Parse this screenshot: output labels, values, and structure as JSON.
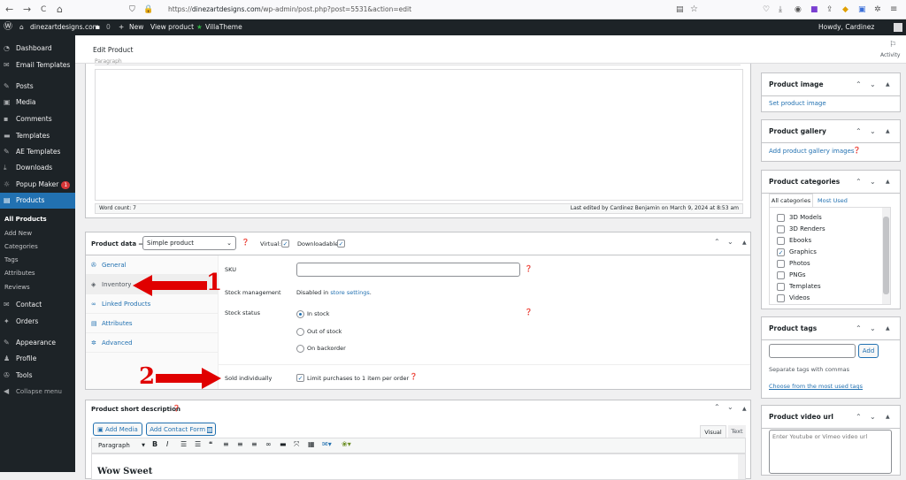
{
  "browser": {
    "url_prefix": "https://",
    "url_domain": "dinezartdesigns.com",
    "url_path": "/wp-admin/post.php?post=5531&action=edit",
    "back": "←",
    "forward": "→",
    "reload": "C",
    "home": "⌂"
  },
  "adminbar": {
    "site": "dinezartdesigns.com",
    "comments": "0",
    "new": "New",
    "view": "View product",
    "villa": "VillaTheme",
    "howdy": "Howdy, Cardinez Benjamin"
  },
  "menu": {
    "items": [
      "Dashboard",
      "Email Templates",
      "Posts",
      "Media",
      "Comments",
      "Templates",
      "AE Templates",
      "Downloads",
      "Popup Maker",
      "Products",
      "Contact",
      "Orders",
      "Appearance",
      "Profile",
      "Tools",
      "Collapse menu"
    ],
    "popup_badge": "1",
    "products_sub": [
      "All Products",
      "Add New",
      "Categories",
      "Tags",
      "Attributes",
      "Reviews"
    ]
  },
  "header": {
    "title": "Edit Product",
    "activity": "Activity"
  },
  "editor": {
    "toolbar_partial": "Paragraph",
    "word_count": "Word count: 7",
    "last_edited": "Last edited by Cardinez Benjamin on March 9, 2024 at 8:53 am"
  },
  "product_data": {
    "label": "Product data —",
    "type": "Simple product",
    "virtual": "Virtual:",
    "downloadable": "Downloadable:",
    "tabs": [
      "General",
      "Inventory",
      "Linked Products",
      "Attributes",
      "Advanced"
    ],
    "sku_label": "SKU",
    "stock_mgmt_label": "Stock management",
    "stock_mgmt_text": "Disabled in",
    "store_settings": "store settings",
    "stock_status_label": "Stock status",
    "stock_options": [
      "In stock",
      "Out of stock",
      "On backorder"
    ],
    "sold_ind_label": "Sold individually",
    "sold_ind_text": "Limit purchases to 1 item per order"
  },
  "annotations": {
    "one": "1",
    "two": "2"
  },
  "short_desc": {
    "title": "Product short description",
    "add_media": "Add Media",
    "add_form": "Add Contact Form",
    "visual": "Visual",
    "text": "Text",
    "paragraph": "Paragraph",
    "preview": "Wow Sweet"
  },
  "sidebar": {
    "product_image": {
      "title": "Product image",
      "link": "Set product image"
    },
    "gallery": {
      "title": "Product gallery",
      "link": "Add product gallery images"
    },
    "categories": {
      "title": "Product categories",
      "tab_all": "All categories",
      "tab_used": "Most Used",
      "items": [
        "3D Models",
        "3D Renders",
        "Ebooks",
        "Graphics",
        "Photos",
        "PNGs",
        "Templates",
        "Videos"
      ]
    },
    "tags": {
      "title": "Product tags",
      "add": "Add",
      "hint": "Separate tags with commas",
      "choose": "Choose from the most used tags"
    },
    "video": {
      "title": "Product video url",
      "placeholder": "Enter Youtube or Vimeo video url"
    }
  }
}
